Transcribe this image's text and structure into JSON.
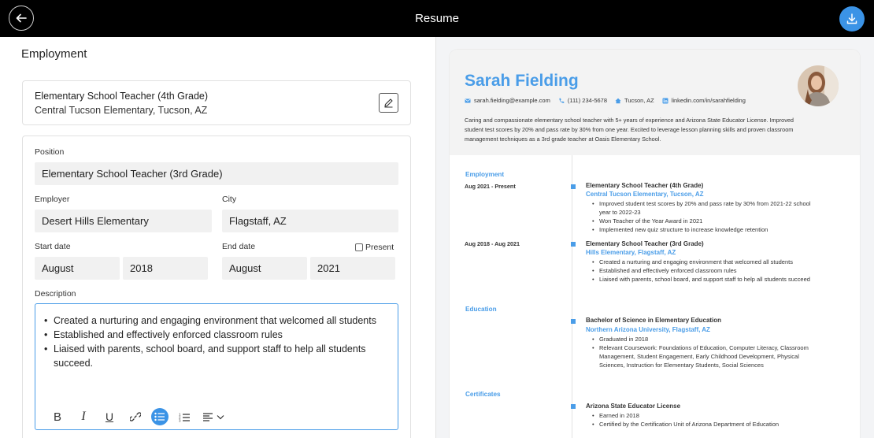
{
  "topbar": {
    "title": "Resume"
  },
  "editor": {
    "section_heading": "Employment",
    "job_card": {
      "title": "Elementary School Teacher (4th Grade)",
      "subtitle": "Central Tucson Elementary, Tucson, AZ"
    },
    "form": {
      "position_label": "Position",
      "position_value": "Elementary School Teacher (3rd Grade)",
      "employer_label": "Employer",
      "employer_value": "Desert Hills Elementary",
      "city_label": "City",
      "city_value": "Flagstaff, AZ",
      "start_label": "Start date",
      "start_month": "August",
      "start_year": "2018",
      "end_label": "End date",
      "end_month": "August",
      "end_year": "2021",
      "present_label": "Present",
      "present_checked": false,
      "description_label": "Description",
      "description_items": [
        "Created a nurturing and engaging environment that welcomed all students",
        "Established and effectively enforced classroom rules",
        "Liaised with parents, school board, and support staff to help all students succeed."
      ],
      "toolbar": {
        "bold": "B",
        "italic": "I",
        "underline": "U"
      }
    }
  },
  "preview": {
    "name": "Sarah Fielding",
    "email": "sarah.fielding@example.com",
    "phone": "(111) 234-5678",
    "location": "Tucson, AZ",
    "linkedin": "linkedin.com/in/sarahfielding",
    "summary": "Caring and compassionate elementary school teacher with 5+ years of experience and Arizona State Educator License. Improved student test scores by 20% and pass rate by 30% from one year. Excited to leverage lesson planning skills and proven classroom management techniques as a 3rd grade teacher at Oasis Elementary School.",
    "employment_heading": "Employment",
    "jobs": [
      {
        "dates": "Aug 2021 - Present",
        "title": "Elementary School Teacher (4th Grade)",
        "employer": "Central Tucson Elementary, Tucson, AZ",
        "bullets": [
          "Improved student test scores by 20% and pass rate by 30% from 2021-22 school year to 2022-23",
          "Won Teacher of the Year Award in 2021",
          "Implemented new quiz structure to increase knowledge retention"
        ]
      },
      {
        "dates": "Aug 2018 - Aug 2021",
        "title": "Elementary School Teacher (3rd Grade)",
        "employer": "Hills Elementary, Flagstaff, AZ",
        "bullets": [
          "Created a nurturing and engaging environment that welcomed all students",
          "Established and effectively enforced classroom rules",
          "Liaised with parents, school board, and support staff to help all students succeed"
        ]
      }
    ],
    "education_heading": "Education",
    "education": {
      "degree": "Bachelor of Science in Elementary Education",
      "school": "Northern Arizona University, Flagstaff, AZ",
      "bullets": [
        "Graduated in 2018",
        "Relevant Coursework: Foundations of Education, Computer Literacy, Classroom Management, Student Engagement, Early Childhood Development, Physical Sciences, Instruction for Elementary Students, Social Sciences"
      ]
    },
    "certificates_heading": "Certificates",
    "certificate": {
      "title": "Arizona State Educator License",
      "bullets": [
        "Earned in 2018",
        "Certified by the Certification Unit of Arizona Department of Education"
      ]
    }
  }
}
